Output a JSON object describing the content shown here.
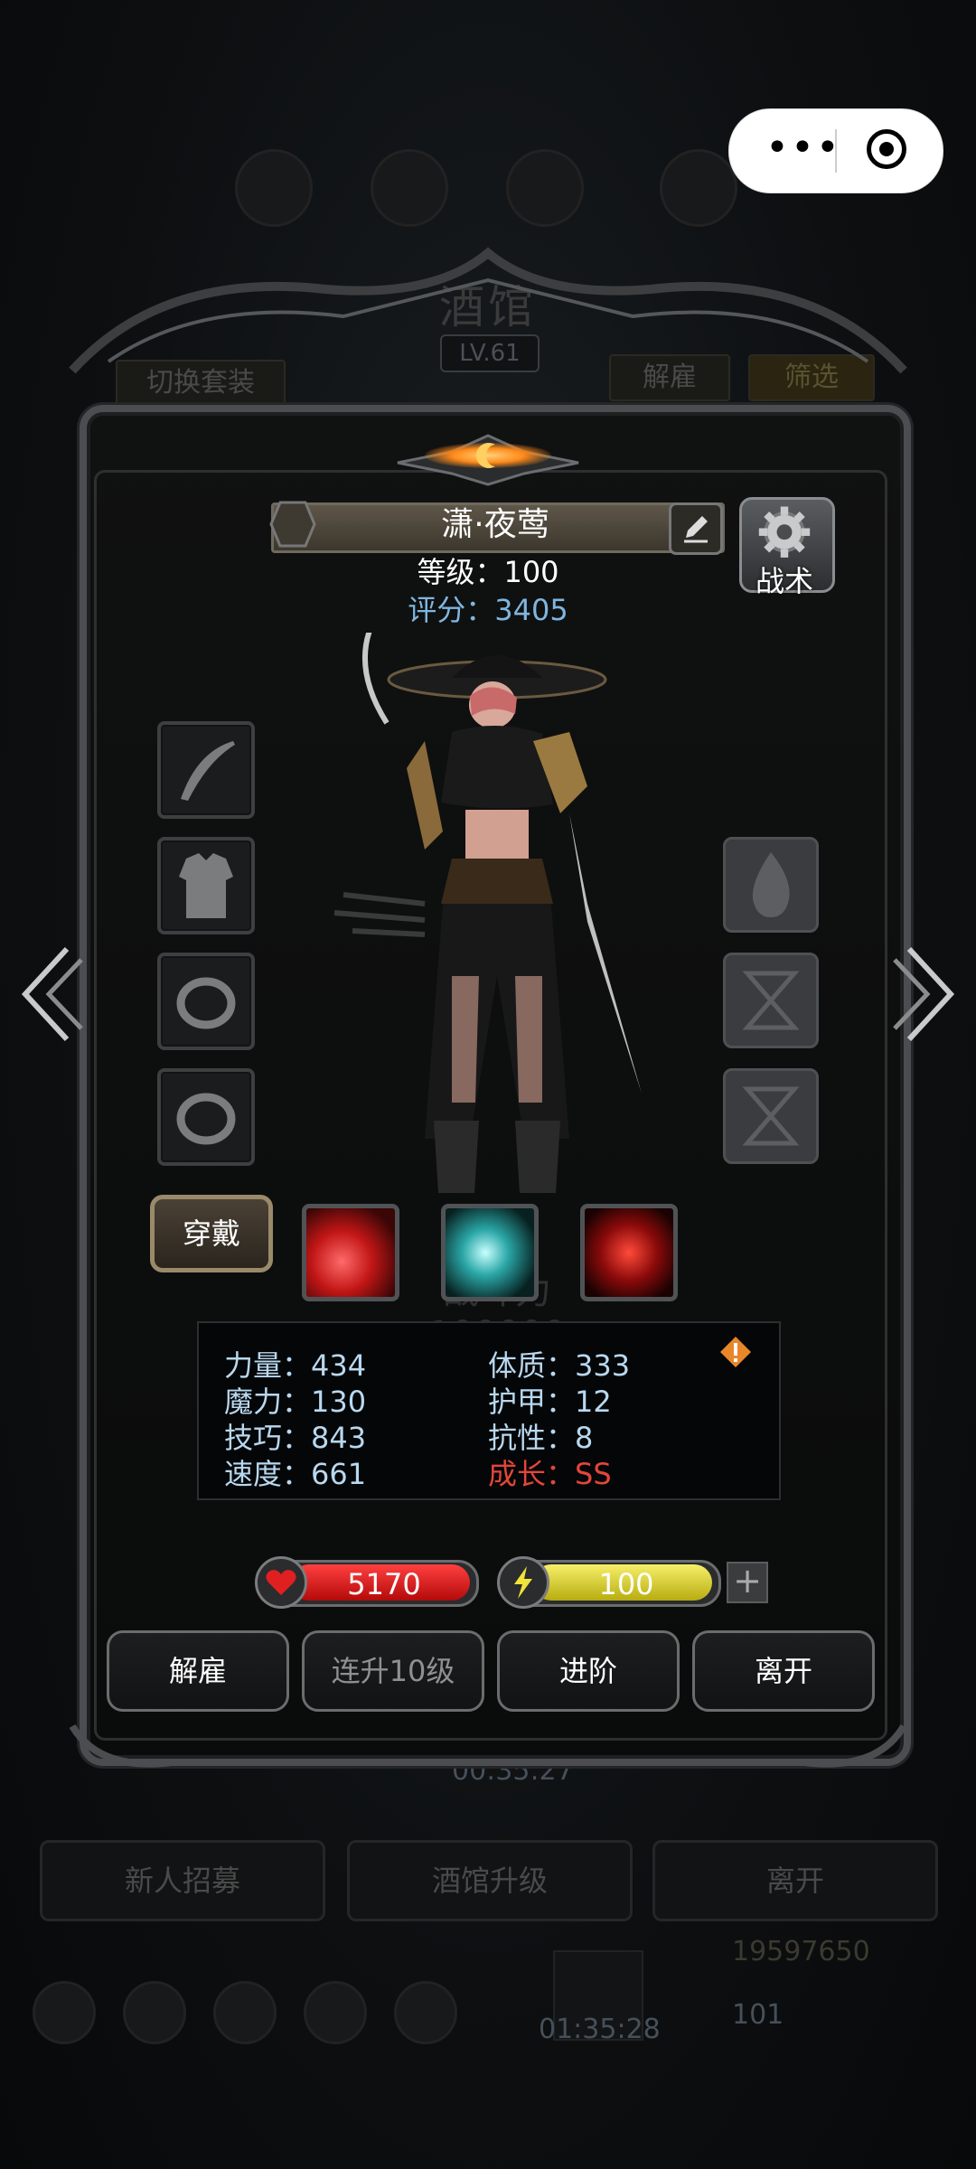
{
  "background": {
    "title": "酒馆",
    "level": "LV.61",
    "switch_outfit": "切换套装",
    "dismiss": "解雇",
    "filter": "筛选",
    "timer": "00:35:27",
    "bottom_buttons": [
      "新人招募",
      "酒馆升级",
      "离开"
    ],
    "gold": "19597650",
    "gift_timer": "01:35:28",
    "gem": "101"
  },
  "capsule": {
    "menu_icon": "more-dots-icon",
    "close_icon": "target-circle-icon"
  },
  "hero": {
    "name": "潇·夜莺",
    "level_text": "等级：100",
    "score_text": "评分：3405",
    "tactic_label": "战术",
    "wear_label": "穿戴",
    "power_watermark": "战斗力 100000"
  },
  "stats": {
    "strength": "力量：434",
    "magic": "魔力：130",
    "skill": "技巧：843",
    "speed": "速度：661",
    "constitution": "体质：333",
    "armor": "护甲：12",
    "resistance": "抗性：8",
    "growth": "成长：SS"
  },
  "bars": {
    "hp": "5170",
    "energy": "100",
    "plus": "+"
  },
  "actions": {
    "dismiss": "解雇",
    "level_up_10": "连升10级",
    "advance": "进阶",
    "leave": "离开"
  },
  "colors": {
    "score": "#7fb6e0",
    "stat": "#b8d8f0",
    "growth": "#e2463a",
    "hp": "#d01818",
    "energy": "#e6dc2a"
  }
}
